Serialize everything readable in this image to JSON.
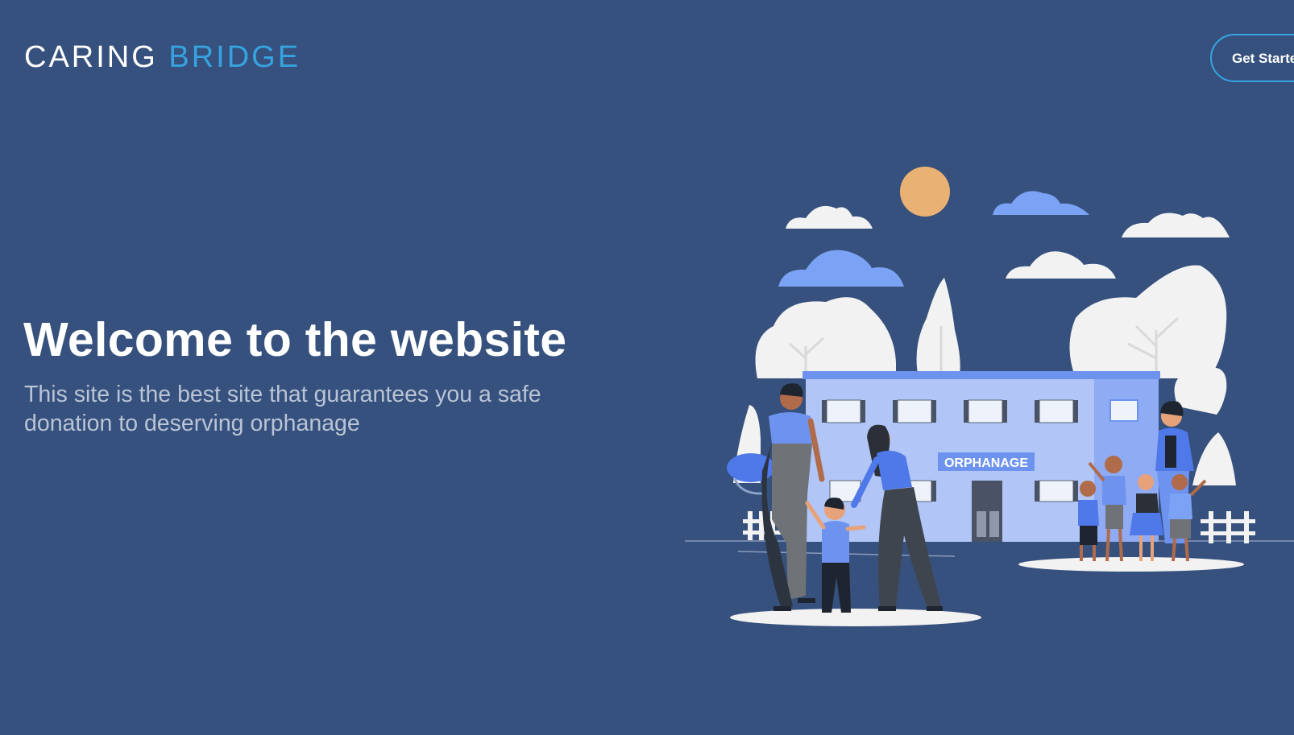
{
  "header": {
    "logo_part1": "CARING",
    "logo_part2": "BRIDGE",
    "cta_label": "Get Started"
  },
  "hero": {
    "title": "Welcome to the website",
    "subtitle": "This site is the best site that guarantees you a safe donation to deserving orphanage"
  },
  "illustration": {
    "building_sign": "ORPHANAGE"
  },
  "colors": {
    "background": "#36517d",
    "accent": "#36a3e0",
    "illustration_blue": "#5a83ec"
  }
}
